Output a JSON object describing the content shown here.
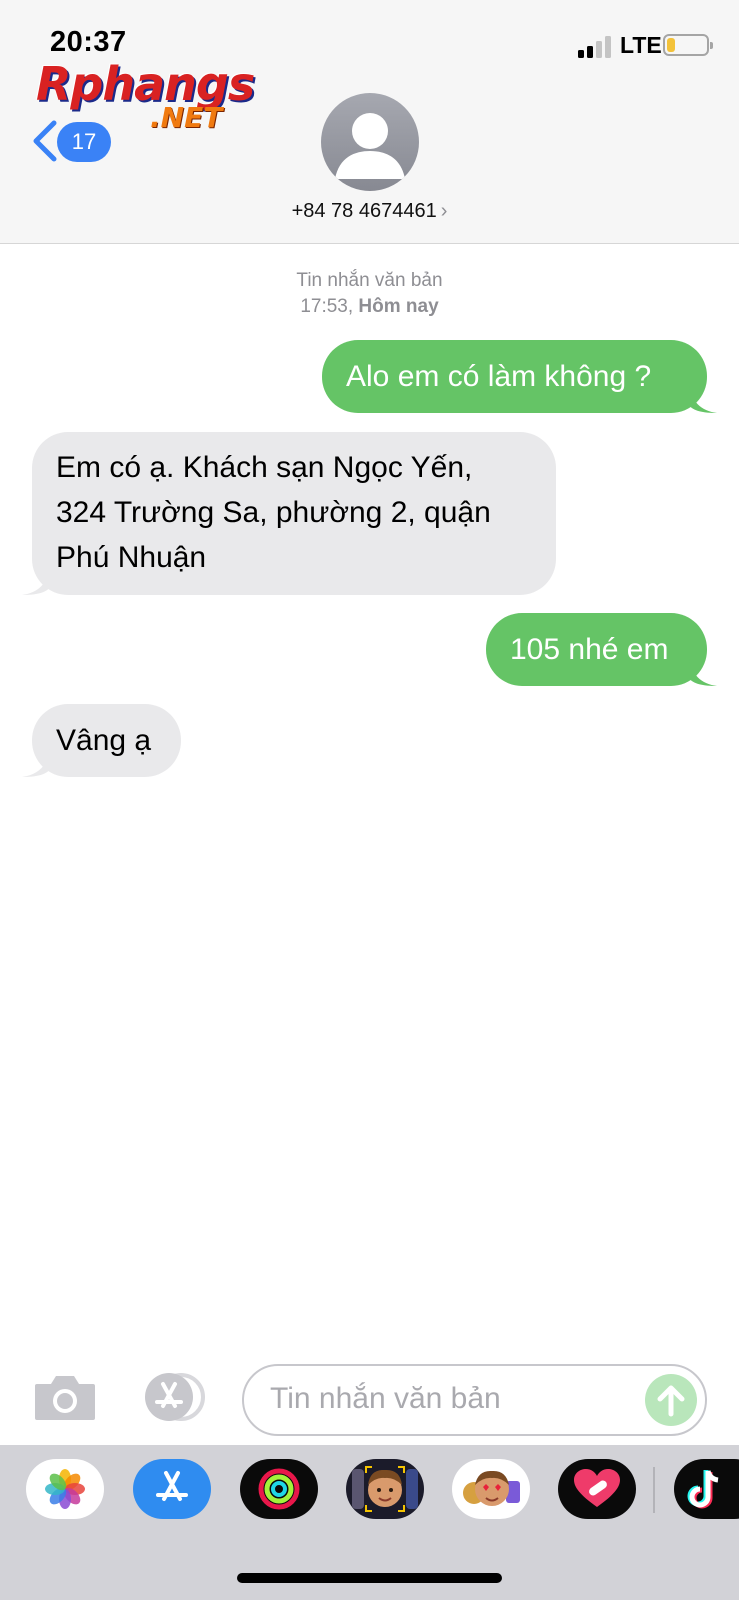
{
  "status_bar": {
    "time": "20:37",
    "network": "LTE",
    "battery_level": 0.2
  },
  "watermark": {
    "brand": "Rphangs",
    "suffix": ".NET"
  },
  "nav": {
    "unread_count": "17"
  },
  "contact": {
    "phone": "+84 78 4674461",
    "chevron": "›"
  },
  "thread": {
    "meta_line1": "Tin nhắn văn bản",
    "meta_time": "17:53,",
    "meta_day": "Hôm nay",
    "messages": [
      {
        "direction": "out",
        "text": "Alo em có làm không ?"
      },
      {
        "direction": "in",
        "lines": [
          "Em có ạ. Khách sạn Ngọc Yến,",
          "324 Trường Sa, phường 2, quận",
          "Phú Nhuận"
        ]
      },
      {
        "direction": "out",
        "text": "105 nhé em"
      },
      {
        "direction": "in",
        "text": "Vâng ạ"
      }
    ]
  },
  "composer": {
    "placeholder": "Tin nhắn văn bản"
  },
  "colors": {
    "outgoing": "#65c466",
    "incoming": "#e9e9eb",
    "accent": "#3a82f6"
  },
  "app_drawer": [
    "photos-icon",
    "app-store-icon",
    "activity-icon",
    "memoji-icon",
    "animoji-stickers-icon",
    "heart-sticker-icon",
    "tiktok-icon"
  ]
}
